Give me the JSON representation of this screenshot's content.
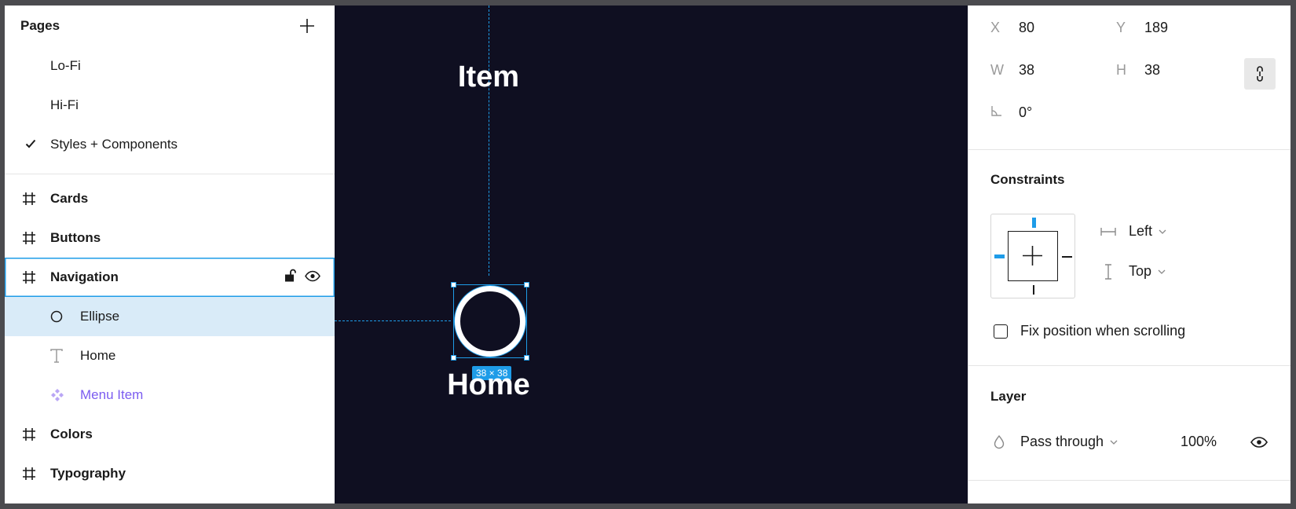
{
  "pages": {
    "title": "Pages",
    "items": [
      {
        "label": "Lo-Fi",
        "current": false
      },
      {
        "label": "Hi-Fi",
        "current": false
      },
      {
        "label": "Styles + Components",
        "current": true
      }
    ]
  },
  "layers": [
    {
      "label": "Cards",
      "type": "frame",
      "icon": "frame-icon"
    },
    {
      "label": "Buttons",
      "type": "frame",
      "icon": "frame-icon"
    },
    {
      "label": "Navigation",
      "type": "frame",
      "icon": "frame-icon",
      "state": "hover"
    },
    {
      "label": "Ellipse",
      "type": "ellipse",
      "icon": "ellipse-icon",
      "state": "selected"
    },
    {
      "label": "Home",
      "type": "text",
      "icon": "text-icon"
    },
    {
      "label": "Menu Item",
      "type": "component",
      "icon": "component-icon"
    },
    {
      "label": "Colors",
      "type": "frame",
      "icon": "frame-icon"
    },
    {
      "label": "Typography",
      "type": "frame",
      "icon": "frame-icon"
    }
  ],
  "canvas": {
    "top_text": "Item",
    "bottom_text": "Home",
    "size_badge": "38 × 38",
    "background": "#0f0f21",
    "accent": "#1e9ce8"
  },
  "properties": {
    "x_label": "X",
    "x_value": "80",
    "y_label": "Y",
    "y_value": "189",
    "w_label": "W",
    "w_value": "38",
    "h_label": "H",
    "h_value": "38",
    "rotation_value": "0°",
    "constraints_title": "Constraints",
    "horizontal_constraint": "Left",
    "vertical_constraint": "Top",
    "fix_position_label": "Fix position when scrolling",
    "layer_title": "Layer",
    "blend_mode": "Pass through",
    "opacity": "100%"
  }
}
